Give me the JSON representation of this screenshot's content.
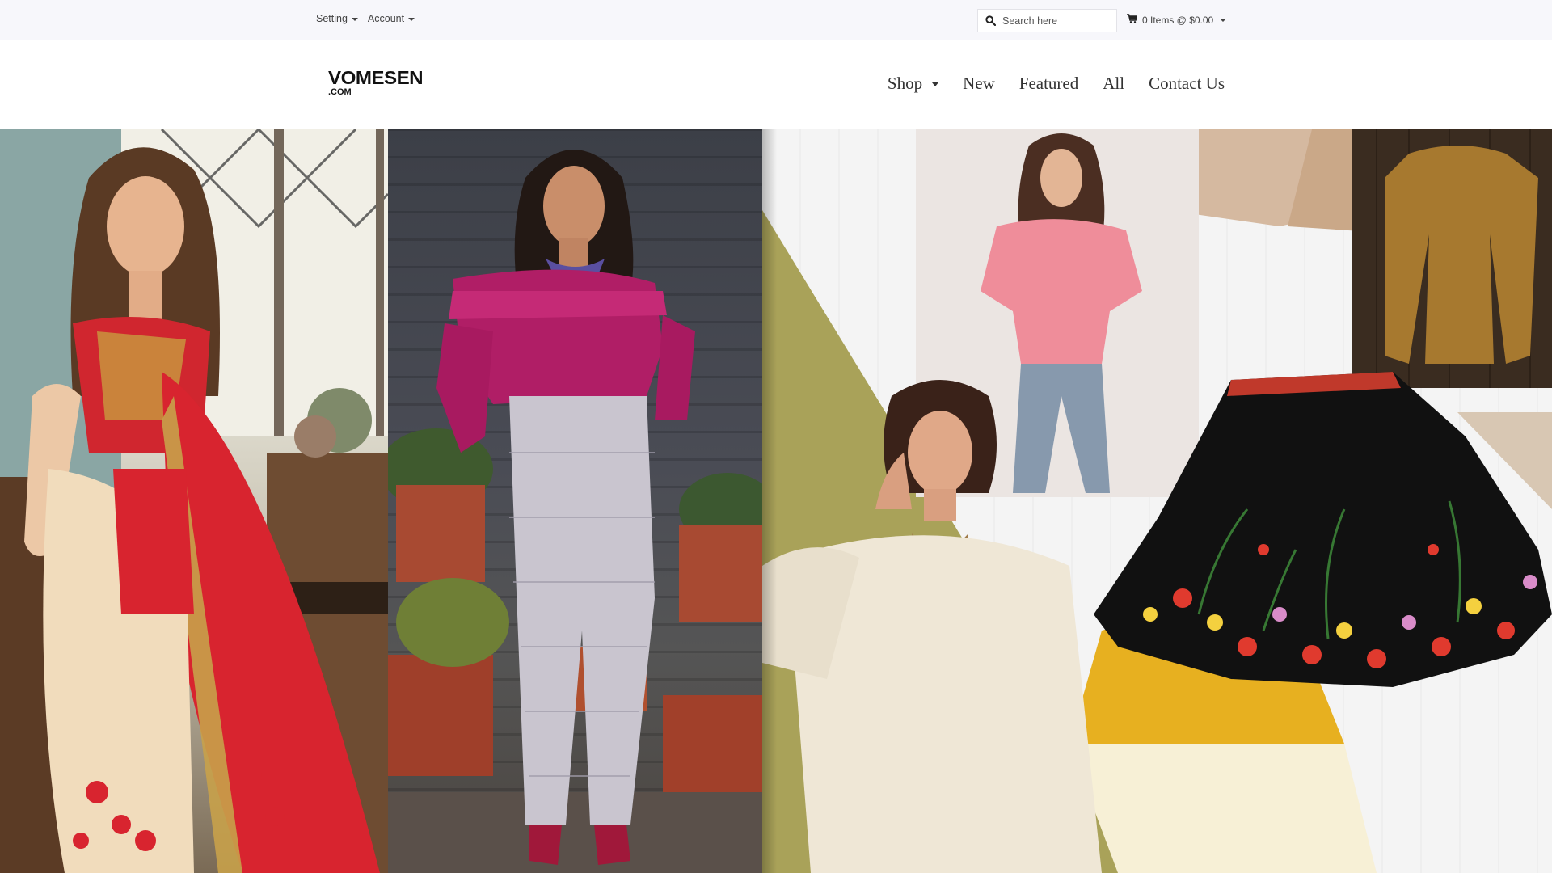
{
  "topbar": {
    "setting_label": "Setting",
    "account_label": "Account",
    "search_placeholder": "Search here",
    "cart_label": "0 Items @ $0.00"
  },
  "header": {
    "logo_brand": "VOMESEN",
    "logo_tld": ".COM",
    "nav": [
      {
        "label": "Shop"
      },
      {
        "label": "New"
      },
      {
        "label": "Featured"
      },
      {
        "label": "All"
      },
      {
        "label": "Contact Us"
      }
    ]
  },
  "colors": {
    "topbar_bg": "#f7f7fb",
    "saree_red": "#d8242f",
    "top_magenta": "#b01e66",
    "olive": "#a9a259",
    "mustard": "#e7b020",
    "pink_top": "#ef8d9a",
    "skirt_black": "#111111"
  },
  "icons": {
    "search": "search-icon",
    "cart": "shopping-cart-icon",
    "dropdown": "caret-down-icon"
  }
}
